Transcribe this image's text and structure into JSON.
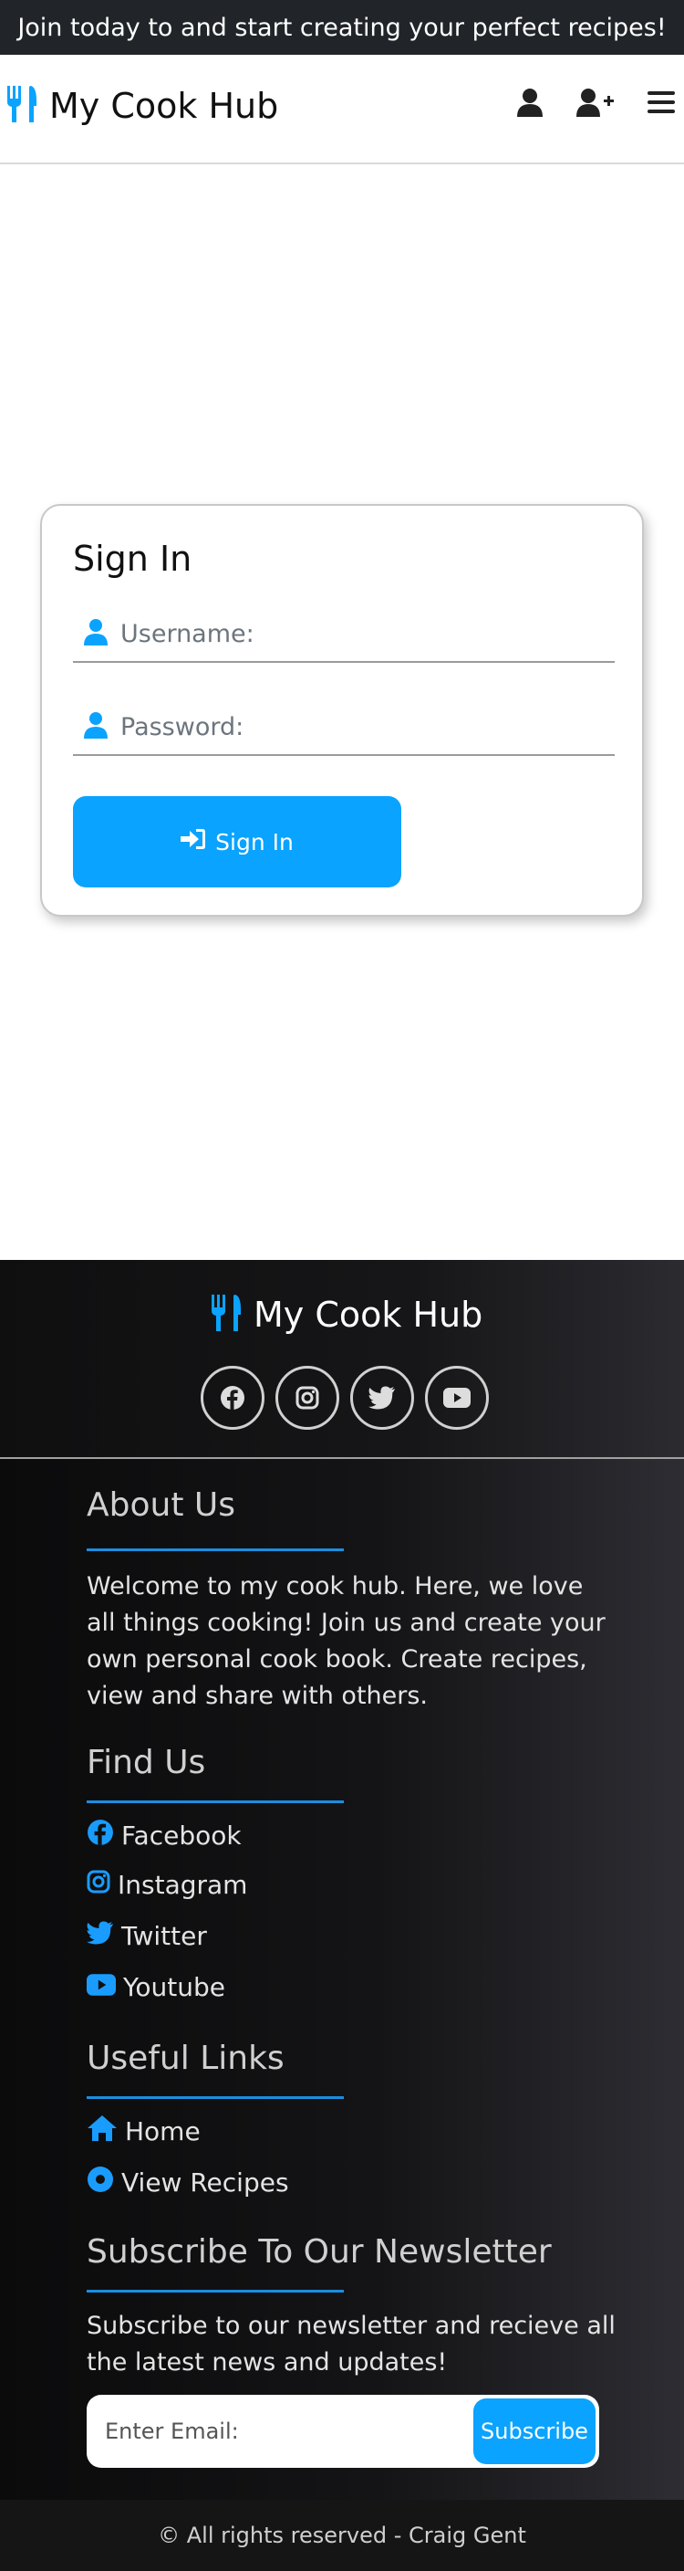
{
  "banner": {
    "text": "Join today to and start creating your perfect recipes!"
  },
  "navbar": {
    "brand": "My Cook Hub",
    "icons": [
      "utensils-icon",
      "user-icon",
      "user-plus-icon",
      "menu-icon"
    ]
  },
  "signin": {
    "title": "Sign In",
    "username_placeholder": "Username:",
    "password_placeholder": "Password:",
    "button_label": "Sign In"
  },
  "footer": {
    "brand": "My Cook Hub",
    "social_icons": [
      "facebook-icon",
      "instagram-icon",
      "twitter-icon",
      "youtube-icon"
    ],
    "about": {
      "title": "About Us",
      "text": "Welcome to my cook hub. Here, we love all things cooking! Join us and create your own personal cook book. Create recipes, view and share with others."
    },
    "find_us": {
      "title": "Find Us",
      "links": [
        "Facebook",
        "Instagram",
        "Twitter",
        "Youtube"
      ]
    },
    "useful_links": {
      "title": "Useful Links",
      "links": [
        "Home",
        "View Recipes"
      ]
    },
    "newsletter": {
      "title": "Subscribe To Our Newsletter",
      "text": "Subscribe to our newsletter and recieve all the latest news and updates!",
      "email_placeholder": "Enter Email:",
      "button_label": "Subscribe"
    },
    "copyright": "© All rights reserved - Craig Gent"
  },
  "colors": {
    "accent": "#0aa3ff",
    "dark": "#212529",
    "rule": "#1b8ee0"
  }
}
